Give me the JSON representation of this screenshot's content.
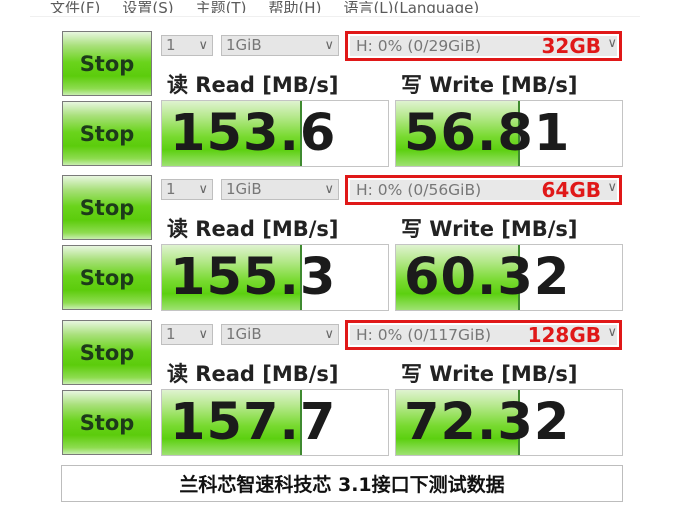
{
  "menu": [
    {
      "label": "文件(F)"
    },
    {
      "label": "设置(S)"
    },
    {
      "label": "主题(T)"
    },
    {
      "label": "帮助(H)"
    },
    {
      "label": "语言(L)(Language)"
    }
  ],
  "groups": [
    {
      "top_stop_label": "Stop",
      "bottom_stop_label": "Stop",
      "count_select": "1",
      "size_select": "1GiB",
      "drive_status": "H: 0% (0/29GiB)",
      "drive_capacity": "32GB",
      "read_label": "读 Read [MB/s]",
      "write_label": "写 Write [MB/s]",
      "read_value": "153.6",
      "write_value": "56.81",
      "read_fill_fraction": 0.61,
      "write_fill_fraction": 0.54
    },
    {
      "top_stop_label": "Stop",
      "bottom_stop_label": "Stop",
      "count_select": "1",
      "size_select": "1GiB",
      "drive_status": "H: 0% (0/56GiB)",
      "drive_capacity": "64GB",
      "read_label": "读 Read [MB/s]",
      "write_label": "写 Write [MB/s]",
      "read_value": "155.3",
      "write_value": "60.32",
      "read_fill_fraction": 0.61,
      "write_fill_fraction": 0.54
    },
    {
      "top_stop_label": "Stop",
      "bottom_stop_label": "Stop",
      "count_select": "1",
      "size_select": "1GiB",
      "drive_status": "H: 0% (0/117GiB)",
      "drive_capacity": "128GB",
      "read_label": "读 Read [MB/s]",
      "write_label": "写 Write [MB/s]",
      "read_value": "157.7",
      "write_value": "72.32",
      "read_fill_fraction": 0.61,
      "write_fill_fraction": 0.54
    }
  ],
  "icons": {
    "dropdown": "chevron-down-icon"
  },
  "colors": {
    "highlight_border": "#e01818",
    "capacity_text": "#e01818",
    "fill_green": "#5cd010"
  },
  "footer": {
    "caption": "兰科芯智速科技芯 3.1接口下测试数据"
  }
}
